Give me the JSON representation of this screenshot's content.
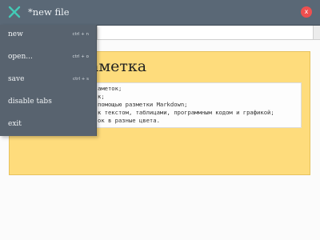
{
  "window": {
    "title": "*new file",
    "close_label": "x"
  },
  "icons": {
    "menu_toggle": "close-x-icon",
    "close": "close-icon"
  },
  "colors": {
    "titlebar": "#5a6876",
    "menu_bg": "#58636f",
    "accent_toggle": "#43c9b6",
    "close_button": "#ef4f4f",
    "note_bg": "#fedc7c"
  },
  "menu": {
    "items": [
      {
        "label": "new",
        "shortcut": "ctrl + n"
      },
      {
        "label": "open...",
        "shortcut": "ctrl + o"
      },
      {
        "label": "save",
        "shortcut": "ctrl + s"
      },
      {
        "label": "disable tabs",
        "shortcut": ""
      },
      {
        "label": "exit",
        "shortcut": ""
      }
    ]
  },
  "note": {
    "heading": "аметка",
    "lines": [
      "аметок;",
      "к;",
      "помощью разметки Markdown;",
      "к текстом, таблицами, программным кодом и графикой;",
      "ок в разные цвета."
    ]
  }
}
